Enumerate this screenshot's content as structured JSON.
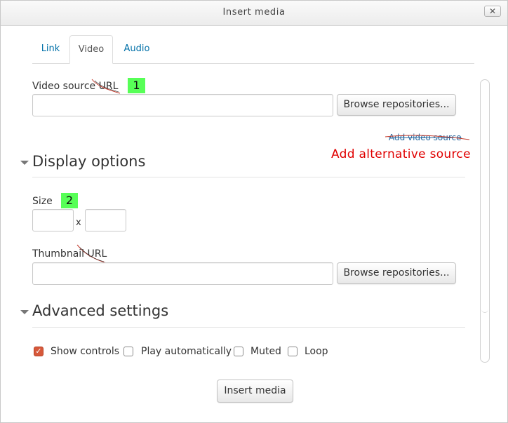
{
  "dialog": {
    "title": "Insert media",
    "close_icon": "close-icon",
    "close_glyph": "✕"
  },
  "tabs": [
    {
      "label": "Link",
      "active": false
    },
    {
      "label": "Video",
      "active": true
    },
    {
      "label": "Audio",
      "active": false
    }
  ],
  "video_source": {
    "label": "Video source URL",
    "value": "",
    "browse_label": "Browse repositories...",
    "badge": "1"
  },
  "add_video_source": {
    "link_label": "Add video source",
    "annotation": "Add alternative source"
  },
  "display_options": {
    "heading": "Display options",
    "size_label": "Size",
    "size_badge": "2",
    "width_value": "",
    "height_value": "",
    "separator": "x",
    "thumbnail_label": "Thumbnail URL",
    "thumbnail_value": "",
    "browse_label": "Browse repositories..."
  },
  "advanced_settings": {
    "heading": "Advanced settings",
    "options": [
      {
        "label": "Show controls",
        "checked": true
      },
      {
        "label": "Play automatically",
        "checked": false
      },
      {
        "label": "Muted",
        "checked": false
      },
      {
        "label": "Loop",
        "checked": false
      }
    ]
  },
  "footer": {
    "insert_label": "Insert media"
  },
  "colors": {
    "link": "#0070a8",
    "badge": "#57ff57",
    "annotation": "#e00000",
    "checkbox_checked": "#d6583a"
  }
}
